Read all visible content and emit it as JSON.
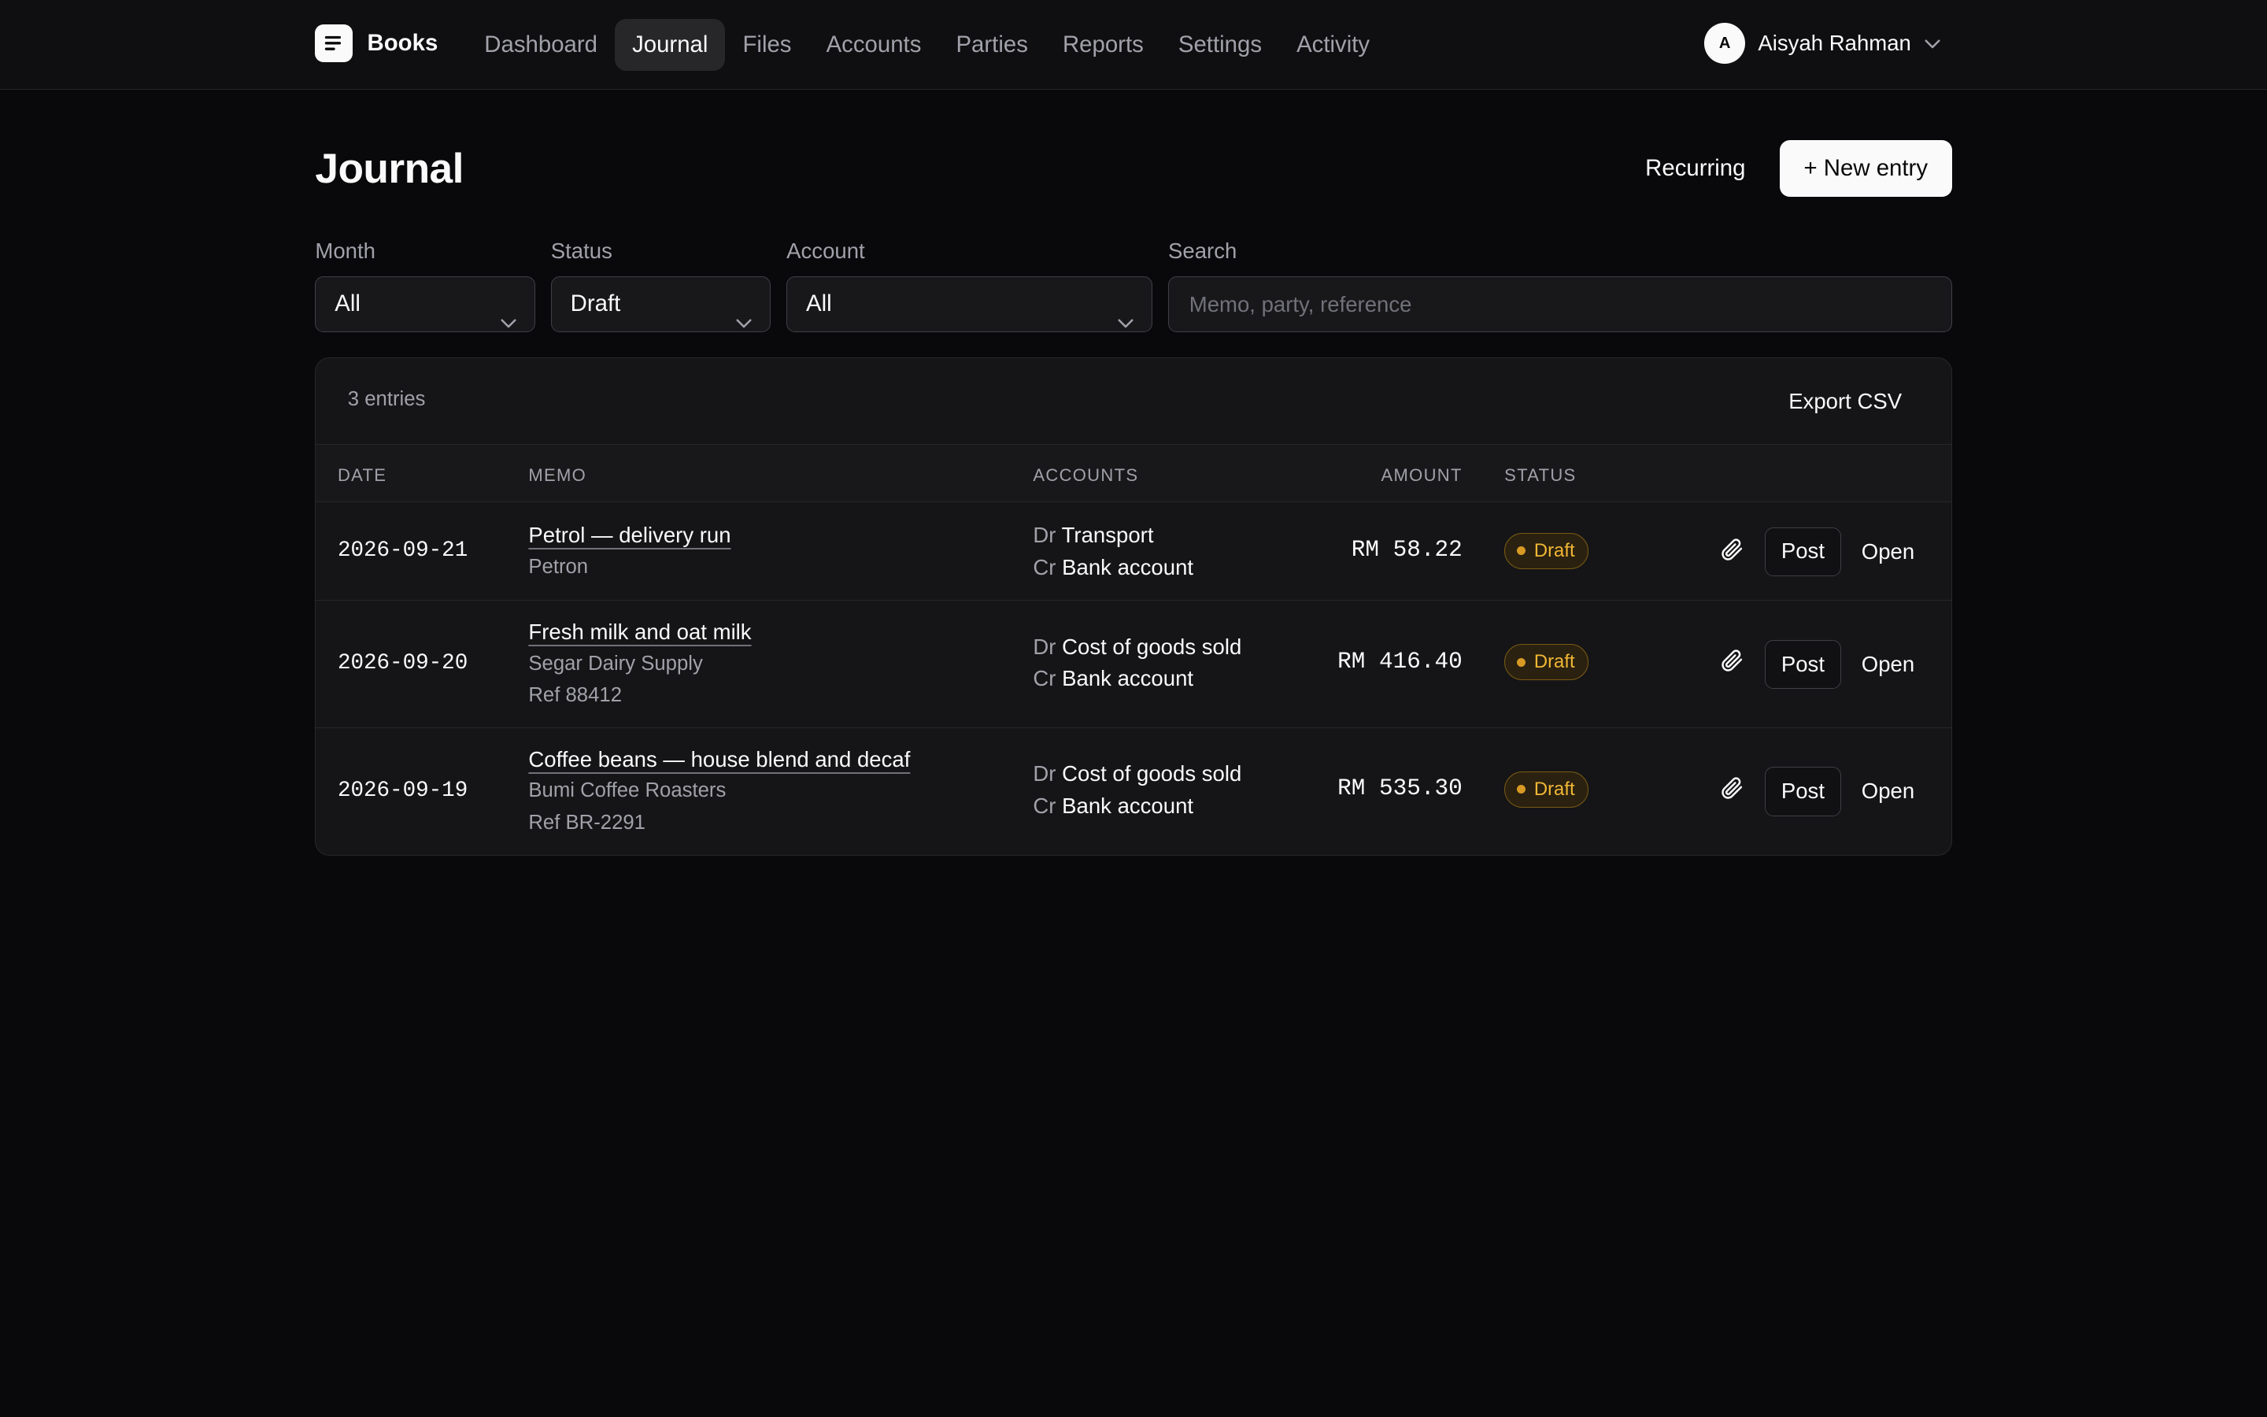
{
  "app": {
    "name": "Books"
  },
  "nav": {
    "items": [
      {
        "label": "Dashboard"
      },
      {
        "label": "Journal"
      },
      {
        "label": "Files"
      },
      {
        "label": "Accounts"
      },
      {
        "label": "Parties"
      },
      {
        "label": "Reports"
      },
      {
        "label": "Settings"
      },
      {
        "label": "Activity"
      }
    ],
    "active": "Journal"
  },
  "user": {
    "initial": "A",
    "name": "Aisyah Rahman"
  },
  "page": {
    "title": "Journal",
    "recurring_label": "Recurring",
    "new_entry_label": "+ New entry"
  },
  "filters": {
    "month": {
      "label": "Month",
      "value": "All"
    },
    "status": {
      "label": "Status",
      "value": "Draft"
    },
    "account": {
      "label": "Account",
      "value": "All"
    },
    "search": {
      "label": "Search",
      "placeholder": "Memo, party, reference",
      "value": ""
    }
  },
  "table": {
    "count_label": "3 entries",
    "export_label": "Export CSV",
    "columns": {
      "date": "DATE",
      "memo": "MEMO",
      "accounts": "ACCOUNTS",
      "amount": "AMOUNT",
      "status": "STATUS"
    },
    "debit_prefix": "Dr",
    "credit_prefix": "Cr",
    "post_label": "Post",
    "open_label": "Open",
    "rows": [
      {
        "date": "2026-09-21",
        "memo": "Petrol — delivery run",
        "party": "Petron",
        "ref": "",
        "debit": "Transport",
        "credit": "Bank account",
        "amount": "RM 58.22",
        "status": "Draft"
      },
      {
        "date": "2026-09-20",
        "memo": "Fresh milk and oat milk",
        "party": "Segar Dairy Supply",
        "ref": "Ref 88412",
        "debit": "Cost of goods sold",
        "credit": "Bank account",
        "amount": "RM 416.40",
        "status": "Draft"
      },
      {
        "date": "2026-09-19",
        "memo": "Coffee beans — house blend and decaf",
        "party": "Bumi Coffee Roasters",
        "ref": "Ref BR-2291",
        "debit": "Cost of goods sold",
        "credit": "Bank account",
        "amount": "RM 535.30",
        "status": "Draft"
      }
    ]
  },
  "colors": {
    "background": "#09090b",
    "surface": "#151517",
    "border": "#27272a",
    "draft_badge": "#f2b735"
  },
  "icons": {
    "brand": "document-lines-icon",
    "chevron": "chevron-down-icon",
    "attach": "paperclip-icon"
  }
}
